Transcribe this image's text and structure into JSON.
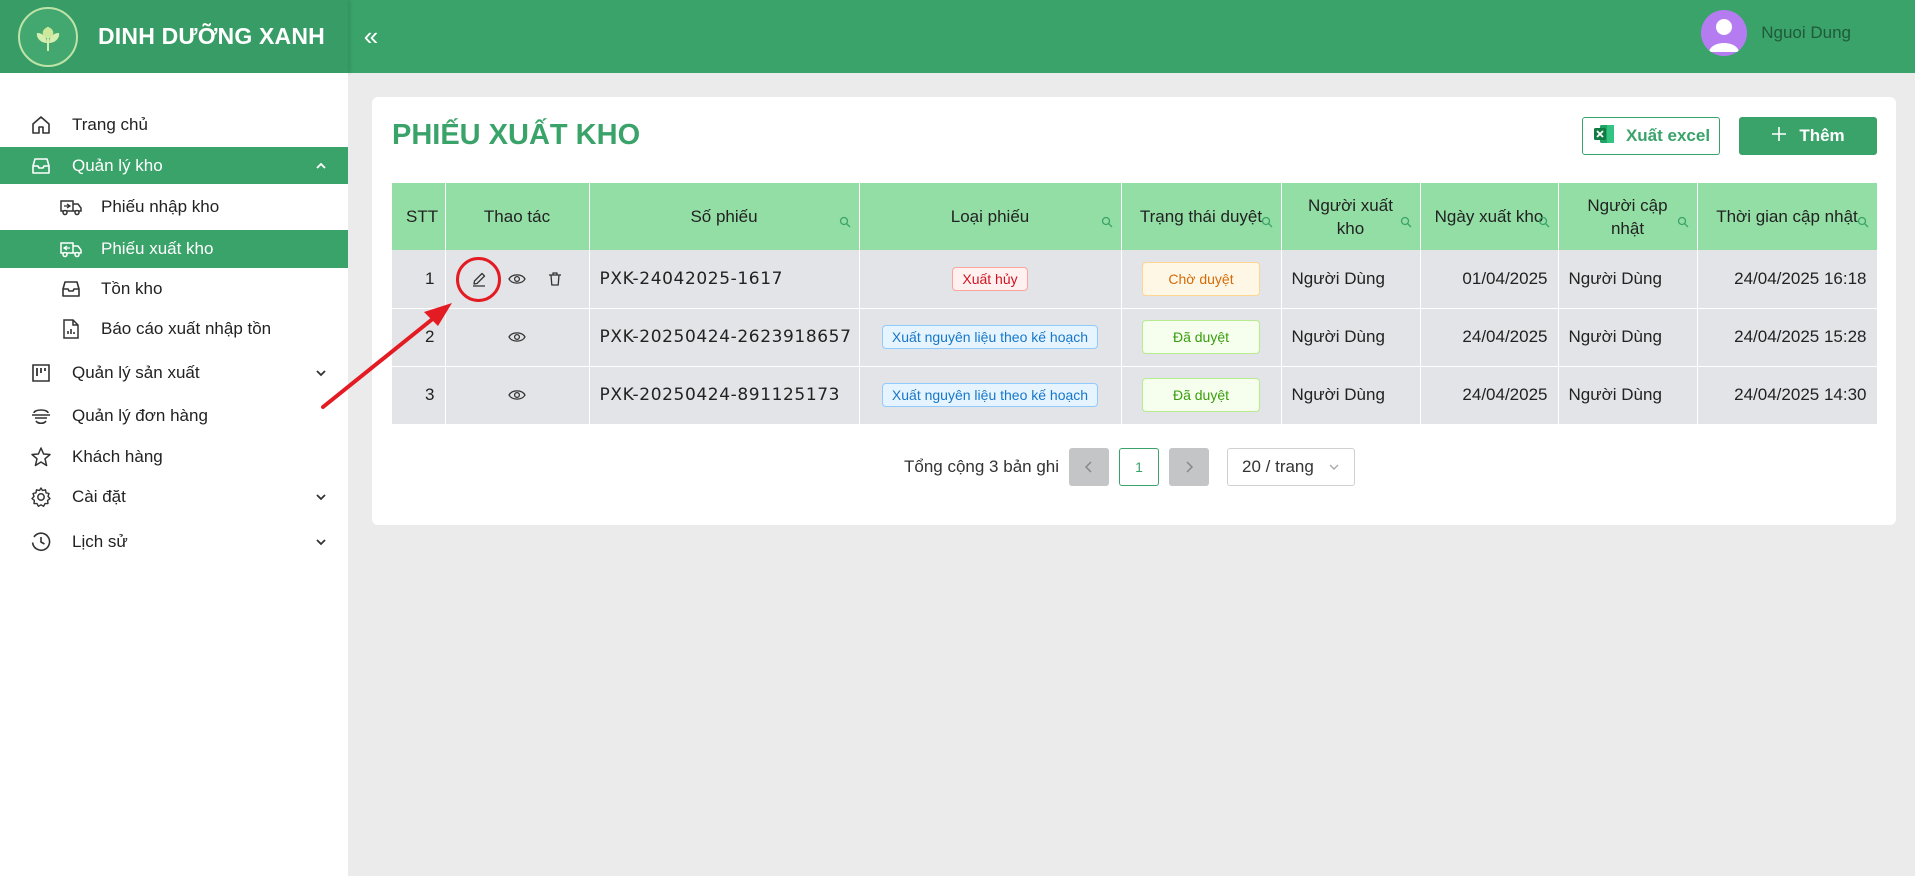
{
  "app": {
    "name": "DINH DƯỠNG XANH",
    "collapse_icon": "«",
    "user_name": "Nguoi Dung"
  },
  "sidebar": {
    "items": [
      {
        "label": "Trang chủ",
        "icon": "home-icon"
      },
      {
        "label": "Quản lý kho",
        "icon": "inbox-icon",
        "expanded": true
      },
      {
        "label": "Phiếu nhập kho",
        "icon": "truck-import-icon"
      },
      {
        "label": "Phiếu xuất kho",
        "icon": "truck-export-icon",
        "active": true
      },
      {
        "label": "Tồn kho",
        "icon": "inbox-icon"
      },
      {
        "label": "Báo cáo xuất nhập tồn",
        "icon": "report-icon"
      },
      {
        "label": "Quản lý sản xuất",
        "icon": "factory-icon"
      },
      {
        "label": "Quản lý đơn hàng",
        "icon": "order-icon"
      },
      {
        "label": "Khách hàng",
        "icon": "star-icon"
      },
      {
        "label": "Cài đặt",
        "icon": "gear-icon"
      },
      {
        "label": "Lịch sử",
        "icon": "history-icon"
      }
    ]
  },
  "page": {
    "title": "PHIẾU XUẤT KHO",
    "export_label": "Xuất excel",
    "add_label": "Thêm"
  },
  "table": {
    "headers": [
      "STT",
      "Thao tác",
      "Số phiếu",
      "Loại phiếu",
      "Trạng thái duyệt",
      "Người xuất kho",
      "Ngày xuất kho",
      "Người cập nhật",
      "Thời gian cập nhật"
    ],
    "rows": [
      {
        "stt": "1",
        "so_phieu": "PXK-24042025-1617",
        "loai": "Xuất hủy",
        "trang_thai": "Chờ duyệt",
        "nguoi_xuat": "Người Dùng",
        "ngay_xuat": "01/04/2025",
        "nguoi_cap_nhat": "Người Dùng",
        "thoi_gian": "24/04/2025 16:18"
      },
      {
        "stt": "2",
        "so_phieu": "PXK-20250424-2623918657",
        "loai": "Xuất nguyên liệu theo kế hoạch",
        "trang_thai": "Đã duyệt",
        "nguoi_xuat": "Người Dùng",
        "ngay_xuat": "24/04/2025",
        "nguoi_cap_nhat": "Người Dùng",
        "thoi_gian": "24/04/2025 15:28"
      },
      {
        "stt": "3",
        "so_phieu": "PXK-20250424-891125173",
        "loai": "Xuất nguyên liệu theo kế hoạch",
        "trang_thai": "Đã duyệt",
        "nguoi_xuat": "Người Dùng",
        "ngay_xuat": "24/04/2025",
        "nguoi_cap_nhat": "Người Dùng",
        "thoi_gian": "24/04/2025 14:30"
      }
    ]
  },
  "pagination": {
    "total_text": "Tổng cộng 3 bản ghi",
    "current_page": "1",
    "page_size": "20 / trang"
  },
  "colors": {
    "primary": "#3aa36a",
    "header_row": "#92dea5",
    "annotation": "#e31b23"
  }
}
